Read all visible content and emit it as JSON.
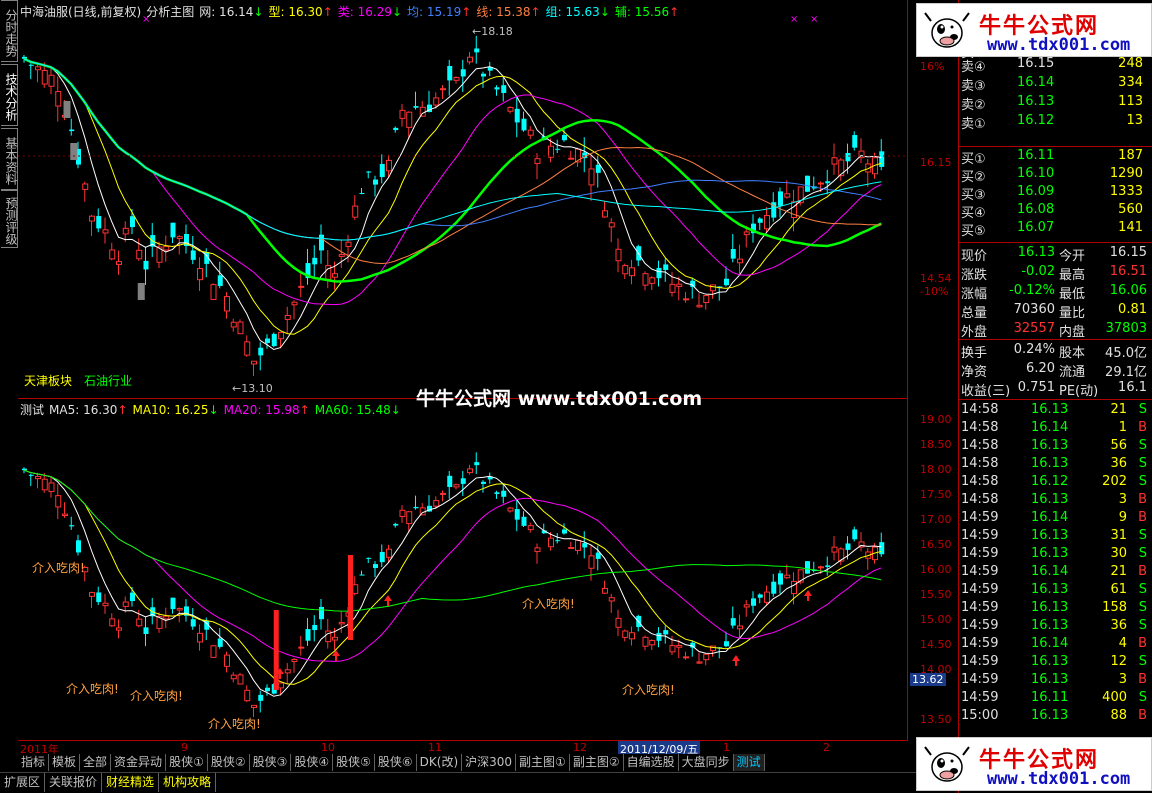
{
  "left_tabs": [
    "分时走势",
    "技术分析",
    "基本资料",
    "预测评级"
  ],
  "top_header": {
    "title": "中海油服(日线,前复权)",
    "indicator": "分析主图",
    "items": [
      {
        "label": "网: 16.14",
        "color": "#e0e0e0",
        "arrow": "↓"
      },
      {
        "label": "型: 16.30",
        "color": "#ffff00",
        "arrow": "↑"
      },
      {
        "label": "类: 16.29",
        "color": "#ff00ff",
        "arrow": "↓"
      },
      {
        "label": "均: 15.19",
        "color": "#4080ff",
        "arrow": "↑"
      },
      {
        "label": "线: 15.38",
        "color": "#ff8040",
        "arrow": "↑"
      },
      {
        "label": "组: 15.63",
        "color": "#00ffff",
        "arrow": "↓"
      },
      {
        "label": "辅: 15.56",
        "color": "#00ff00",
        "arrow": "↑"
      }
    ]
  },
  "main_chart_labels": {
    "high_label": "18.18",
    "low_label": "13.10",
    "sector1": "天津板块",
    "sector2": "石油行业"
  },
  "y_axis_top": [
    {
      "v": "16%"
    },
    {
      "v": "16.15"
    },
    {
      "v": "14.54"
    },
    {
      "v": "-10%"
    }
  ],
  "sub_header": {
    "name": "测试",
    "items": [
      {
        "label": "MA5: 16.30",
        "color": "#e0e0e0",
        "arrow": "↑"
      },
      {
        "label": "MA10: 16.25",
        "color": "#ffff00",
        "arrow": "↓"
      },
      {
        "label": "MA20: 15.98",
        "color": "#ff00ff",
        "arrow": "↑"
      },
      {
        "label": "MA60: 15.48",
        "color": "#00ff00",
        "arrow": "↓"
      }
    ]
  },
  "y_axis_sub": [
    "19.00",
    "18.50",
    "18.00",
    "17.50",
    "17.00",
    "16.50",
    "16.00",
    "15.50",
    "15.00",
    "14.50",
    "14.00",
    "13.62",
    "13.50",
    "13.00"
  ],
  "annotations": [
    "介入吃肉",
    "介入吃肉",
    "介入吃肉",
    "介入吃肉",
    "介入吃肉",
    "介入吃肉"
  ],
  "date_axis": [
    "2011年",
    "9",
    "10",
    "11",
    "12",
    "2011/12/09/五",
    "1",
    "2"
  ],
  "tabs1": [
    "指标",
    "模板",
    "全部",
    "资金异动",
    "股侠①",
    "股侠②",
    "股侠③",
    "股侠④",
    "股侠⑤",
    "股侠⑥",
    "DK(改)",
    "沪深300",
    "副主图①",
    "副主图②",
    "自编选股",
    "大盘同步",
    "测试"
  ],
  "tabs2": [
    "扩展区",
    "关联报价",
    "财经精选",
    "机构攻略"
  ],
  "center_watermark": "牛牛公式网 www.tdx001.com",
  "watermark": {
    "title": "牛牛公式网",
    "url": "www.tdx001.com"
  },
  "order_book": {
    "sells": [
      {
        "label": "卖⑤",
        "price": "16.16",
        "vol": "449"
      },
      {
        "label": "卖④",
        "price": "16.15",
        "vol": "248"
      },
      {
        "label": "卖③",
        "price": "16.14",
        "vol": "334"
      },
      {
        "label": "卖②",
        "price": "16.13",
        "vol": "113"
      },
      {
        "label": "卖①",
        "price": "16.12",
        "vol": "13"
      }
    ],
    "buys": [
      {
        "label": "买①",
        "price": "16.11",
        "vol": "187"
      },
      {
        "label": "买②",
        "price": "16.10",
        "vol": "1290"
      },
      {
        "label": "买③",
        "price": "16.09",
        "vol": "1333"
      },
      {
        "label": "买④",
        "price": "16.08",
        "vol": "560"
      },
      {
        "label": "买⑤",
        "price": "16.07",
        "vol": "141"
      }
    ]
  },
  "quote": [
    {
      "l1": "现价",
      "v1": "16.13",
      "c1": "g",
      "l2": "今开",
      "v2": "16.15",
      "c2": "w"
    },
    {
      "l1": "涨跌",
      "v1": "-0.02",
      "c1": "g",
      "l2": "最高",
      "v2": "16.51",
      "c2": "r"
    },
    {
      "l1": "涨幅",
      "v1": "-0.12%",
      "c1": "g",
      "l2": "最低",
      "v2": "16.06",
      "c2": "g"
    },
    {
      "l1": "总量",
      "v1": "70360",
      "c1": "w",
      "l2": "量比",
      "v2": "0.81",
      "c2": "y"
    },
    {
      "l1": "外盘",
      "v1": "32557",
      "c1": "r",
      "l2": "内盘",
      "v2": "37803",
      "c2": "g"
    }
  ],
  "fundamentals": [
    {
      "l1": "换手",
      "v1": "0.24%",
      "l2": "股本",
      "v2": "45.0亿"
    },
    {
      "l1": "净资",
      "v1": "6.20",
      "l2": "流通",
      "v2": "29.1亿"
    },
    {
      "l1": "收益(三)",
      "v1": "0.751",
      "l2": "PE(动)",
      "v2": "16.1"
    }
  ],
  "ticks": [
    {
      "t": "14:58",
      "p": "16.13",
      "v": "21",
      "s": "S"
    },
    {
      "t": "14:58",
      "p": "16.14",
      "v": "1",
      "s": "B"
    },
    {
      "t": "14:58",
      "p": "16.13",
      "v": "56",
      "s": "S"
    },
    {
      "t": "14:58",
      "p": "16.13",
      "v": "36",
      "s": "S"
    },
    {
      "t": "14:58",
      "p": "16.12",
      "v": "202",
      "s": "S"
    },
    {
      "t": "14:58",
      "p": "16.13",
      "v": "3",
      "s": "B"
    },
    {
      "t": "14:59",
      "p": "16.14",
      "v": "9",
      "s": "B"
    },
    {
      "t": "14:59",
      "p": "16.13",
      "v": "31",
      "s": "S"
    },
    {
      "t": "14:59",
      "p": "16.13",
      "v": "30",
      "s": "S"
    },
    {
      "t": "14:59",
      "p": "16.14",
      "v": "21",
      "s": "B"
    },
    {
      "t": "14:59",
      "p": "16.13",
      "v": "61",
      "s": "S"
    },
    {
      "t": "14:59",
      "p": "16.13",
      "v": "158",
      "s": "S"
    },
    {
      "t": "14:59",
      "p": "16.13",
      "v": "36",
      "s": "S"
    },
    {
      "t": "14:59",
      "p": "16.14",
      "v": "4",
      "s": "B"
    },
    {
      "t": "14:59",
      "p": "16.13",
      "v": "12",
      "s": "S"
    },
    {
      "t": "14:59",
      "p": "16.13",
      "v": "3",
      "s": "B"
    },
    {
      "t": "14:59",
      "p": "16.11",
      "v": "400",
      "s": "S"
    },
    {
      "t": "15:00",
      "p": "16.13",
      "v": "88",
      "s": "B"
    }
  ],
  "colors": {
    "up": "#ff3232",
    "down": "#00ffff",
    "ma5": "#ffffff",
    "ma10": "#ffff00",
    "ma20": "#ff00ff",
    "ma60": "#00ff00",
    "axis": "#b00000"
  }
}
